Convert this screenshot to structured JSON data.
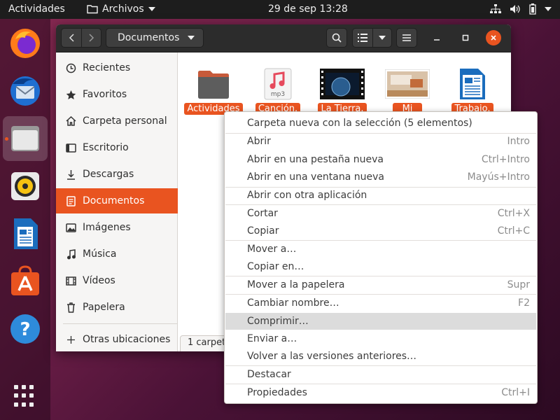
{
  "topbar": {
    "activities": "Actividades",
    "app_menu": "Archivos",
    "clock": "29 de sep  13:28"
  },
  "dock": {
    "items": [
      {
        "icon": "firefox-icon"
      },
      {
        "icon": "thunderbird-icon"
      },
      {
        "icon": "files-icon"
      },
      {
        "icon": "rhythmbox-icon"
      },
      {
        "icon": "libreoffice-writer-icon"
      },
      {
        "icon": "software-icon"
      },
      {
        "icon": "help-icon"
      },
      {
        "icon": "show-apps-icon"
      }
    ]
  },
  "window": {
    "path": "Documentos",
    "sidebar": [
      {
        "label": "Recientes",
        "icon": "clock-icon"
      },
      {
        "label": "Favoritos",
        "icon": "star-icon"
      },
      {
        "label": "Carpeta personal",
        "icon": "home-icon"
      },
      {
        "label": "Escritorio",
        "icon": "desktop-icon"
      },
      {
        "label": "Descargas",
        "icon": "download-icon"
      },
      {
        "label": "Documentos",
        "icon": "document-icon"
      },
      {
        "label": "Imágenes",
        "icon": "image-icon"
      },
      {
        "label": "Música",
        "icon": "music-icon"
      },
      {
        "label": "Vídeos",
        "icon": "video-icon"
      },
      {
        "label": "Papelera",
        "icon": "trash-icon"
      },
      {
        "label": "Otras ubicaciones",
        "icon": "plus-icon"
      }
    ],
    "files": [
      {
        "label": "Actividades"
      },
      {
        "label": "Canción.",
        "badge": "mp3"
      },
      {
        "label": "La Tierra."
      },
      {
        "label": "Mi"
      },
      {
        "label": "Trabajo."
      }
    ],
    "status": "1 carpet"
  },
  "context_menu": {
    "items": [
      {
        "label": "Carpeta nueva con la selección (5 elementos)",
        "accel": ""
      },
      {
        "label": "Abrir",
        "accel": "Intro"
      },
      {
        "label": "Abrir en una pestaña nueva",
        "accel": "Ctrl+Intro"
      },
      {
        "label": "Abrir en una ventana nueva",
        "accel": "Mayús+Intro"
      },
      {
        "label": "Abrir con otra aplicación",
        "accel": ""
      },
      {
        "label": "Cortar",
        "accel": "Ctrl+X"
      },
      {
        "label": "Copiar",
        "accel": "Ctrl+C"
      },
      {
        "label": "Mover a…",
        "accel": ""
      },
      {
        "label": "Copiar en…",
        "accel": ""
      },
      {
        "label": "Mover a la papelera",
        "accel": "Supr"
      },
      {
        "label": "Cambiar nombre…",
        "accel": "F2"
      },
      {
        "label": "Comprimir…",
        "accel": ""
      },
      {
        "label": "Enviar a…",
        "accel": ""
      },
      {
        "label": "Volver a las versiones anteriores…",
        "accel": ""
      },
      {
        "label": "Destacar",
        "accel": ""
      },
      {
        "label": "Propiedades",
        "accel": "Ctrl+I"
      }
    ]
  },
  "colors": {
    "accent": "#e95420",
    "headerbar": "#2c2c2c",
    "topbar": "#1d1d1d"
  }
}
